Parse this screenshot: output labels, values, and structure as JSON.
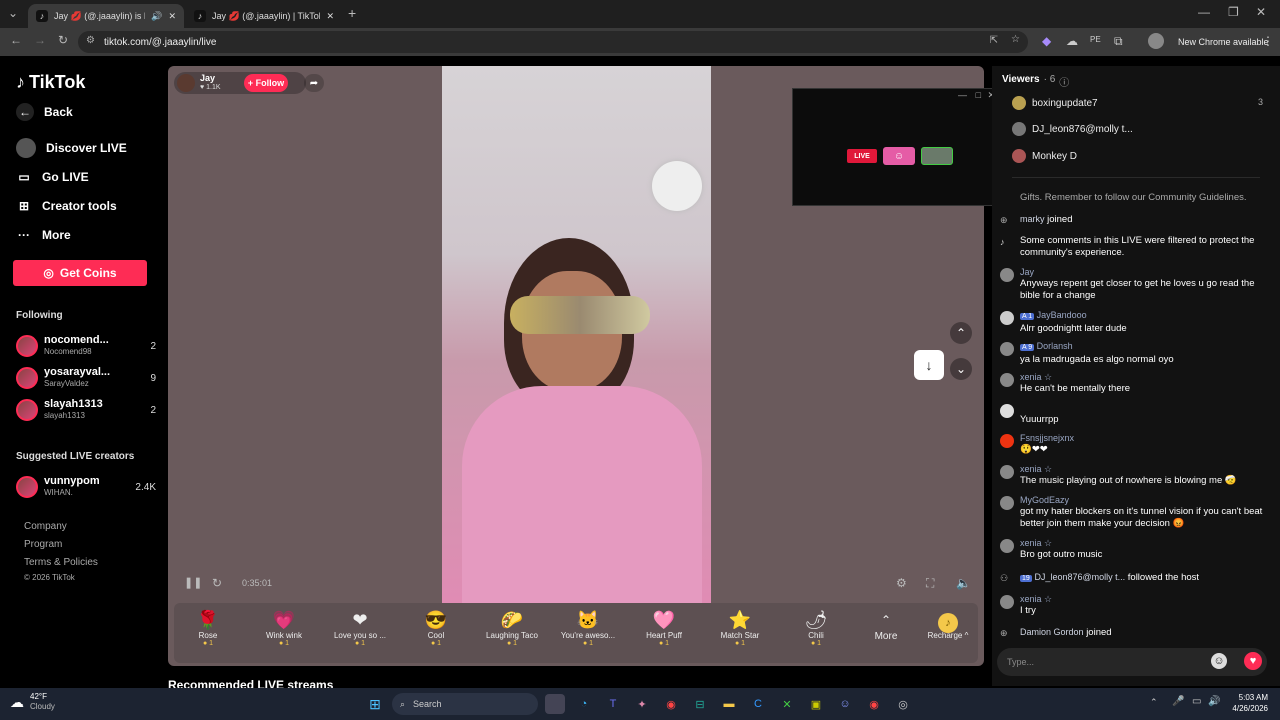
{
  "tabs": [
    {
      "label": "Jay 💋 (@.jaaaylin) is LIVE"
    },
    {
      "label": "Jay 💋 (@.jaaaylin) | TikTok"
    }
  ],
  "address": {
    "url": "tiktok.com/@.jaaaylin/live",
    "new_chrome": "New Chrome available"
  },
  "sidebar": {
    "logo": "TikTok",
    "back": "Back",
    "nav": [
      "Discover LIVE",
      "Go LIVE",
      "Creator tools",
      "More"
    ],
    "get_coins": "Get Coins",
    "following_title": "Following",
    "following": [
      {
        "name": "nocomend...",
        "sub": "Nocomend98",
        "count": "2"
      },
      {
        "name": "yosarayval...",
        "sub": "SarayValdez",
        "count": "9"
      },
      {
        "name": "slayah1313",
        "sub": "slayah1313",
        "count": "2"
      }
    ],
    "suggested_title": "Suggested LIVE creators",
    "suggested": [
      {
        "name": "vunnypom",
        "sub": "WIHAN.",
        "count": "2.4K"
      }
    ],
    "footer": [
      "Company",
      "Program",
      "Terms & Policies",
      "© 2026 TikTok"
    ]
  },
  "player": {
    "host_name": "Jay",
    "host_likes": "♥ 1.1K",
    "follow": "+ Follow",
    "time": "0:35:01",
    "gifts": [
      {
        "name": "Rose",
        "cost": "1",
        "icon": "🌹"
      },
      {
        "name": "Wink wink",
        "cost": "1",
        "icon": "💗"
      },
      {
        "name": "Love you so ...",
        "cost": "1",
        "icon": "❤"
      },
      {
        "name": "Cool",
        "cost": "1",
        "icon": "😎"
      },
      {
        "name": "Laughing Taco",
        "cost": "1",
        "icon": "🌮"
      },
      {
        "name": "You're aweso...",
        "cost": "1",
        "icon": "🐱"
      },
      {
        "name": "Heart Puff",
        "cost": "1",
        "icon": "🩷"
      },
      {
        "name": "Match Star",
        "cost": "1",
        "icon": "⭐"
      },
      {
        "name": "Chili",
        "cost": "1",
        "icon": "🌶"
      }
    ],
    "more": "More",
    "recharge": "Recharge ^",
    "recommended": "Recommended LIVE streams"
  },
  "popup": {
    "live_badge": "LIVE"
  },
  "panel": {
    "viewers_title": "Viewers",
    "viewers_count": "· 6",
    "viewers": [
      {
        "name": "boxingupdate7",
        "count": "3"
      },
      {
        "name": "DJ_leon876@molly t..."
      },
      {
        "name": "Monkey D"
      }
    ],
    "comments": [
      {
        "name": "",
        "text": "Gifts. Remember to follow our Community Guidelines.",
        "type": "system"
      },
      {
        "name": "marky",
        "text": "joined",
        "type": "join"
      },
      {
        "name": "",
        "text": "Some comments in this LIVE were filtered to protect the community's experience.",
        "type": "system"
      },
      {
        "name": "Jay",
        "text": "Anyways repent get closer to get he loves u go read the bible for a change",
        "type": "msg"
      },
      {
        "name": "JayBandooo",
        "badge": "A 1",
        "text": "Alrr goodnightt later dude",
        "type": "msg"
      },
      {
        "name": "Dorlansh",
        "badge": "A 9",
        "text": "ya la madrugada es algo normal oyo",
        "type": "msg"
      },
      {
        "name": "xenia ☆",
        "text": "He can't be mentally there",
        "type": "msg"
      },
      {
        "name": "",
        "text": "Yuuurrpp",
        "type": "msg"
      },
      {
        "name": "Fsnsjjsnejxnx",
        "text": "😲❤❤",
        "type": "msg"
      },
      {
        "name": "xenia ☆",
        "text": "The music playing out of nowhere is blowing me 🤕",
        "type": "msg"
      },
      {
        "name": "MyGodEazy",
        "text": "got my hater blockers on it's tunnel vision if you can't beat better join them make your decision 😡",
        "type": "msg"
      },
      {
        "name": "xenia ☆",
        "text": "Bro got outro music",
        "type": "msg"
      },
      {
        "name": "DJ_leon876@molly t...",
        "badge": "19",
        "text": "followed the host",
        "type": "follow"
      },
      {
        "name": "xenia ☆",
        "text": "I try",
        "type": "msg"
      },
      {
        "name": "Damion Gordon",
        "text": "joined",
        "type": "join"
      }
    ],
    "input_placeholder": "Type..."
  },
  "taskbar": {
    "weather_temp": "42°F",
    "weather_desc": "Cloudy",
    "search": "Search",
    "time": "5:03 AM",
    "date": "4/26/2026"
  },
  "colors": {
    "brand": "#fe2c55",
    "panel": "#121212",
    "player_bg": "#6a5a5c"
  }
}
